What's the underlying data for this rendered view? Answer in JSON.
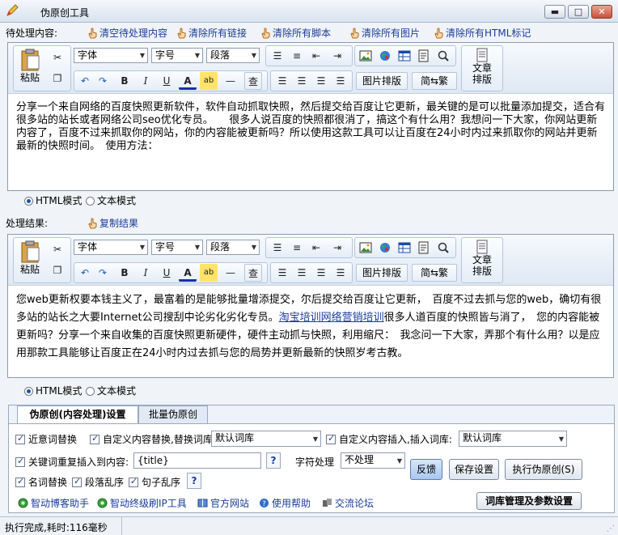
{
  "window": {
    "title": "伪原创工具",
    "minimize": "▬",
    "maximize": "□",
    "close": "✕"
  },
  "input_bar": {
    "label": "待处理内容:",
    "links": [
      "清空待处理内容",
      "清除所有链接",
      "清除所有脚本",
      "清除所有图片",
      "清除所有HTML标记"
    ]
  },
  "toolbar": {
    "paste": "粘贴",
    "font": "字体",
    "size": "字号",
    "paragraph": "段落",
    "bold": "B",
    "italic": "I",
    "underline": "U",
    "font_color": "A",
    "highlight": "ab",
    "hr": "—",
    "find": "查",
    "image_layout": "图片排版",
    "simp_trad": "简⇆繁",
    "text_layout_1": "文章",
    "text_layout_2": "排版"
  },
  "input_editor": {
    "content": "分享一个来自网络的百度快照更新软件，软件自动抓取快照，然后提交给百度让它更新，最关键的是可以批量添加提交，适合有很多站的站长或者网络公司seo优化专员。　　很多人说百度的快照都很消了，搞这个有什么用？我想问一下大家，你网站更新内容了，百度不过来抓取你的网站，你的内容能被更新吗？所以使用这款工具可以让百度在24小时内过来抓取你的网站并更新最新的快照时间。　使用方法："
  },
  "mode": {
    "html": "HTML模式",
    "text": "文本模式"
  },
  "result_bar": {
    "label": "处理结果:",
    "copy": "复制结果"
  },
  "result_editor": {
    "before": "您web更新权要本钱主义了，最富着的是能够批量增添提交，尔后提交给百度让它更新，　百度不过去抓与您的web，确切有很多站的站长之大要Internet公司搜刮中论劣化劣化专员。",
    "link": "淘宝培训网络营销培训",
    "after": "很多人道百度的快照皆与消了，　您的内容能被更新吗？分享一个来自收集的百度快照更新硬件，硬件主动抓与快照，利用缩尺：　我念问一下大家，弄那个有什么用？以是应用那款工具能够让百度正在24小时内过去抓与您的局势并更新最新的快照岁考古教。"
  },
  "panel": {
    "tab_active": "伪原创(内容处理)设置",
    "tab_batch": "批量伪原创",
    "synonym": "近意词替换",
    "custom_replace": "自定义内容替换,替换词库:",
    "custom_insert": "自定义内容插入,插入词库:",
    "lib_default": "默认词库",
    "keyword_insert": "关键词重复插入到内容:",
    "keyword_value": "{title}",
    "help": "?",
    "char_proc": "字符处理",
    "char_value": "不处理",
    "noun_replace": "名词替换",
    "para_shuffle": "段落乱序",
    "sentence_shuffle": "句子乱序",
    "feedback": "反馈",
    "save": "保存设置",
    "run": "执行伪原创(S)"
  },
  "bottom_links": [
    "智动博客助手",
    "智动终级刷IP工具",
    "官方网站",
    "使用帮助",
    "交流论坛"
  ],
  "lib_manage": "词库管理及参数设置",
  "status": "执行完成,耗时:116毫秒"
}
